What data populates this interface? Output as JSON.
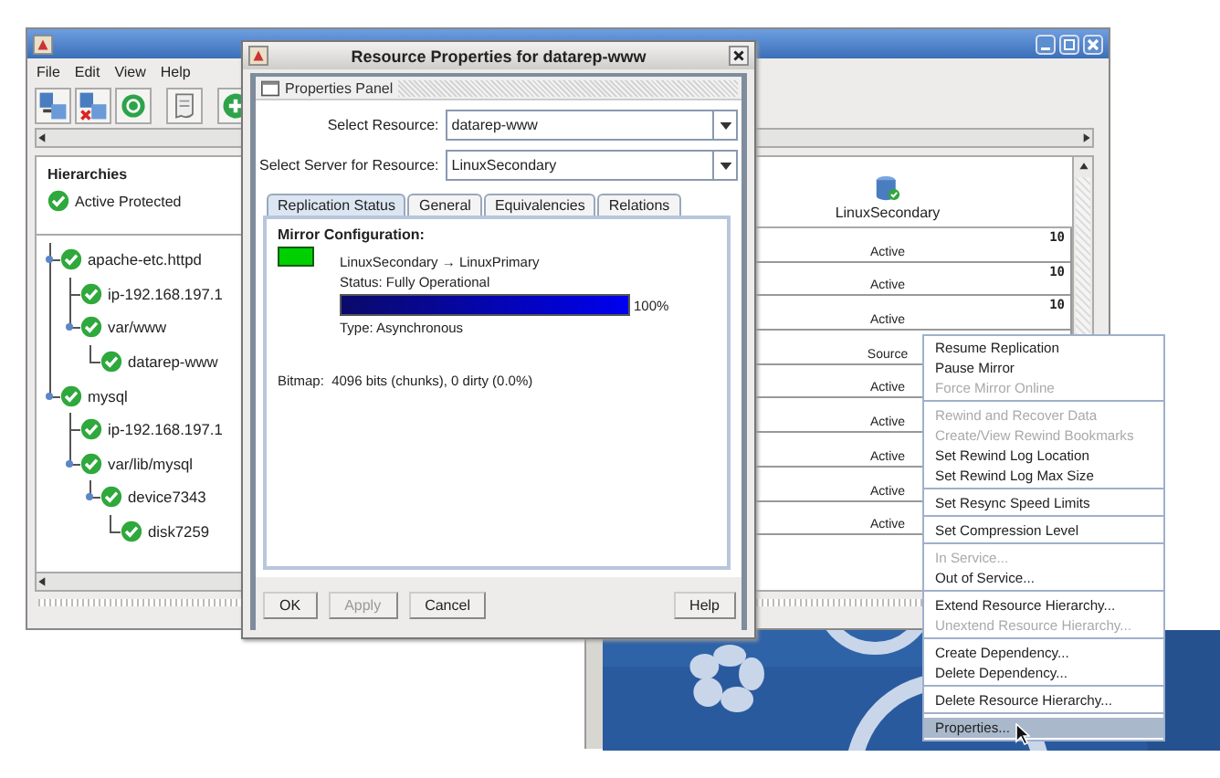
{
  "main_window": {
    "menu": [
      "File",
      "Edit",
      "View",
      "Help"
    ],
    "hierarchies": {
      "title": "Hierarchies",
      "legend": "Active Protected"
    },
    "tree": [
      {
        "label": "apache-etc.httpd",
        "expanded": true,
        "children": [
          {
            "label": "ip-192.168.197.1"
          },
          {
            "label": "var/www",
            "expanded": true,
            "children": [
              {
                "label": "datarep-www"
              }
            ]
          }
        ]
      },
      {
        "label": "mysql",
        "expanded": true,
        "children": [
          {
            "label": "ip-192.168.197.1"
          },
          {
            "label": "var/lib/mysql",
            "expanded": true,
            "children": [
              {
                "label": "device7343",
                "expanded": true,
                "children": [
                  {
                    "label": "disk7259"
                  }
                ]
              }
            ]
          }
        ]
      }
    ],
    "server_column": "LinuxSecondary",
    "rows": [
      {
        "status": "Active",
        "count": "10"
      },
      {
        "status": "Active",
        "count": "10"
      },
      {
        "status": "Active",
        "count": "10"
      },
      {
        "status": "Source"
      },
      {
        "status": "Active"
      },
      {
        "status": "Active"
      },
      {
        "status": "Active"
      },
      {
        "status": "Active"
      },
      {
        "status": "Active"
      }
    ]
  },
  "dialog": {
    "title": "Resource Properties for datarep-www",
    "panel_title": "Properties Panel",
    "fields": [
      {
        "label": "Select Resource:",
        "value": "datarep-www"
      },
      {
        "label": "Select Server for Resource:",
        "value": "LinuxSecondary"
      }
    ],
    "tabs": [
      {
        "label": "Replication Status",
        "selected": true
      },
      {
        "label": "General",
        "selected": false
      },
      {
        "label": "Equivalencies",
        "selected": false
      },
      {
        "label": "Relations",
        "selected": false
      }
    ],
    "mirror": {
      "heading": "Mirror Configuration:",
      "direction": "LinuxSecondary → LinuxPrimary",
      "status": "Status: Fully Operational",
      "level": 1,
      "percent": "100%",
      "type": "Type: Asynchronous",
      "bitmap": "Bitmap:  4096 bits (chunks), 0 dirty (0.0%)"
    },
    "buttons": [
      {
        "label": "OK",
        "disabled": false
      },
      {
        "label": "Apply",
        "disabled": true
      },
      {
        "label": "Cancel",
        "disabled": false
      },
      {
        "label": "Help",
        "disabled": false
      }
    ]
  },
  "context_menu": {
    "groups": [
      [
        {
          "label": "Resume Replication",
          "disabled": false,
          "selected": false
        },
        {
          "label": "Pause Mirror",
          "disabled": false,
          "selected": false
        },
        {
          "label": "Force Mirror Online",
          "disabled": true,
          "selected": false
        }
      ],
      [
        {
          "label": "Rewind and Recover Data",
          "disabled": true,
          "selected": false
        },
        {
          "label": "Create/View Rewind Bookmarks",
          "disabled": true,
          "selected": false
        },
        {
          "label": "Set Rewind Log Location",
          "disabled": false,
          "selected": false
        },
        {
          "label": "Set Rewind Log Max Size",
          "disabled": false,
          "selected": false
        }
      ],
      [
        {
          "label": "Set Resync Speed Limits",
          "disabled": false,
          "selected": false
        }
      ],
      [
        {
          "label": "Set Compression Level",
          "disabled": false,
          "selected": false
        }
      ],
      [
        {
          "label": "In Service...",
          "disabled": true,
          "selected": false
        },
        {
          "label": "Out of Service...",
          "disabled": false,
          "selected": false
        }
      ],
      [
        {
          "label": "Extend Resource Hierarchy...",
          "disabled": false,
          "selected": false
        },
        {
          "label": "Unextend Resource Hierarchy...",
          "disabled": true,
          "selected": false
        }
      ],
      [
        {
          "label": "Create Dependency...",
          "disabled": false,
          "selected": false
        },
        {
          "label": "Delete Dependency...",
          "disabled": false,
          "selected": false
        }
      ],
      [
        {
          "label": "Delete Resource Hierarchy...",
          "disabled": false,
          "selected": false
        }
      ],
      [
        {
          "label": "Properties...",
          "disabled": false,
          "selected": true
        }
      ]
    ]
  }
}
